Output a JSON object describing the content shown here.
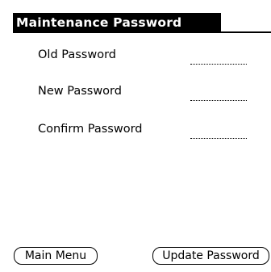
{
  "title": "Maintenance Password",
  "fields": [
    {
      "label": "Old Password",
      "value": ""
    },
    {
      "label": "New Password",
      "value": ""
    },
    {
      "label": "Confirm Password",
      "value": ""
    }
  ],
  "buttons": {
    "main_menu": "Main Menu",
    "update_password": "Update Password"
  },
  "colors": {
    "foreground": "#000000",
    "background": "#ffffff"
  }
}
